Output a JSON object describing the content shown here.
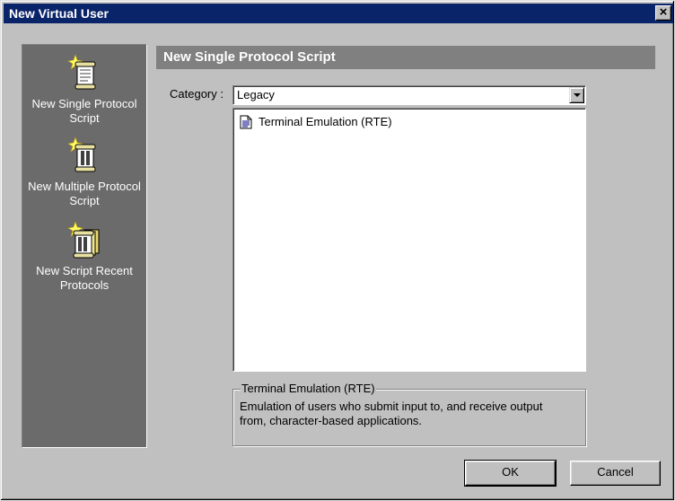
{
  "window": {
    "title": "New Virtual User",
    "close_label": "×"
  },
  "sidebar": {
    "items": [
      {
        "label": "New Single Protocol Script",
        "icon": "single-protocol-script-icon"
      },
      {
        "label": "New Multiple Protocol Script",
        "icon": "multiple-protocol-script-icon"
      },
      {
        "label": "New Script Recent Protocols",
        "icon": "recent-protocols-script-icon"
      }
    ]
  },
  "main": {
    "header": "New Single Protocol Script",
    "category_label": "Category :",
    "category_value": "Legacy",
    "protocols": [
      {
        "label": "Terminal Emulation (RTE)",
        "icon": "document-icon"
      }
    ],
    "description": {
      "title": "Terminal Emulation (RTE)",
      "text": "Emulation of users who submit input to, and receive output from, character-based applications."
    }
  },
  "buttons": {
    "ok": "OK",
    "cancel": "Cancel"
  }
}
